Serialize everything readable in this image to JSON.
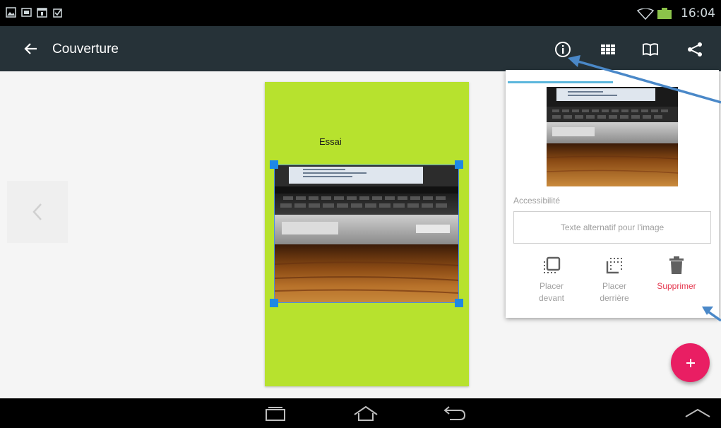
{
  "status_bar": {
    "time": "16:04",
    "left_icons": [
      "gallery-icon",
      "screen-icon",
      "calendar-icon",
      "clipboard-icon"
    ],
    "right_icons": [
      "wifi-icon",
      "battery-icon"
    ]
  },
  "toolbar": {
    "title": "Couverture",
    "back_icon": "back-arrow-icon",
    "actions": [
      "info-icon",
      "grid-icon",
      "book-icon",
      "share-icon"
    ]
  },
  "page": {
    "text": "Essai",
    "background": "#b7e22e"
  },
  "panel": {
    "accessibility_label": "Accessibilité",
    "alt_text_placeholder": "Texte alternatif pour l'image",
    "actions": [
      {
        "line1": "Placer",
        "line2": "devant",
        "icon": "bring-front-icon"
      },
      {
        "line1": "Placer",
        "line2": "derrière",
        "icon": "send-back-icon"
      },
      {
        "label": "Supprimer",
        "icon": "trash-icon"
      }
    ]
  },
  "fab": {
    "icon": "plus-icon",
    "color": "#e91e63"
  },
  "nav_bar": {
    "buttons": [
      "recent-apps-icon",
      "home-icon",
      "back-icon",
      "expand-icon"
    ]
  },
  "colors": {
    "toolbar": "#263238",
    "accent": "#5bb6dc",
    "selection": "#1e88e5",
    "delete": "#e53950",
    "annotation_arrow": "#4a88c8"
  }
}
